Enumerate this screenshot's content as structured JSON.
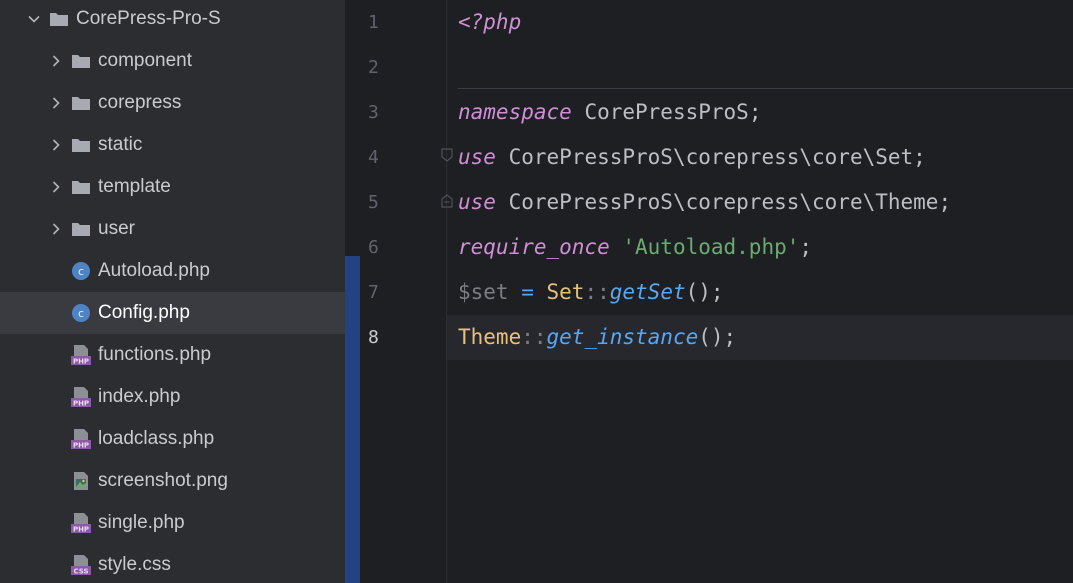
{
  "tree": {
    "root": {
      "label": "CorePress-Pro-S",
      "icon": "folder-icon",
      "expanded": true
    },
    "folders": [
      {
        "label": "component",
        "icon": "folder-icon"
      },
      {
        "label": "corepress",
        "icon": "folder-icon"
      },
      {
        "label": "static",
        "icon": "folder-icon"
      },
      {
        "label": "template",
        "icon": "folder-icon"
      },
      {
        "label": "user",
        "icon": "folder-icon"
      }
    ],
    "files": [
      {
        "label": "Autoload.php",
        "icon": "php-class-icon"
      },
      {
        "label": "Config.php",
        "icon": "php-class-icon",
        "selected": true
      },
      {
        "label": "functions.php",
        "icon": "php-file-icon"
      },
      {
        "label": "index.php",
        "icon": "php-file-icon"
      },
      {
        "label": "loadclass.php",
        "icon": "php-file-icon"
      },
      {
        "label": "screenshot.png",
        "icon": "image-file-icon"
      },
      {
        "label": "single.php",
        "icon": "php-file-icon"
      },
      {
        "label": "style.css",
        "icon": "css-file-icon"
      }
    ],
    "icon_text": {
      "php": "PHP",
      "css": "CSS",
      "class": "c"
    }
  },
  "gutter": {
    "lines": [
      "1",
      "2",
      "3",
      "4",
      "5",
      "6",
      "7",
      "8"
    ],
    "current_line": "8"
  },
  "code": {
    "line1": {
      "open_tag": "<?php"
    },
    "line3": {
      "kw": "namespace",
      "name": " CorePressProS",
      "semi": ";"
    },
    "line4": {
      "kw": "use",
      "path": " CorePressProS\\corepress\\core\\Set",
      "semi": ";"
    },
    "line5": {
      "kw": "use",
      "path": " CorePressProS\\corepress\\core\\Theme",
      "semi": ";"
    },
    "line6": {
      "kw": "require_once",
      "space": " ",
      "str": "'Autoload.php'",
      "semi": ";"
    },
    "line7": {
      "var": "$set",
      "eq": " = ",
      "cls": "Set",
      "sep": "::",
      "fn": "getSet",
      "call": "();"
    },
    "line8": {
      "cls": "Theme",
      "sep": "::",
      "fn": "get_instance",
      "call": "();"
    }
  },
  "colors": {
    "sidebar_bg": "#2b2d30",
    "editor_bg": "#1e1f22",
    "selection": "#393b40",
    "scroll_strip": "#214283",
    "keyword": "#cf8ed6",
    "string": "#6aab73",
    "class_name": "#e8c27a",
    "function": "#56a8f5"
  }
}
